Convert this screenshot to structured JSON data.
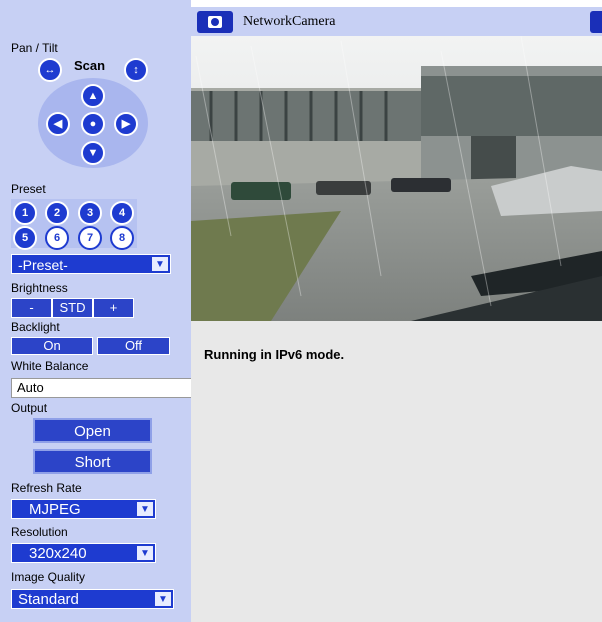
{
  "header": {
    "title": "NetworkCamera"
  },
  "pan_tilt": {
    "label": "Pan / Tilt",
    "scan_label": "Scan"
  },
  "preset": {
    "label": "Preset",
    "numbers": [
      "1",
      "2",
      "3",
      "4",
      "5",
      "6",
      "7",
      "8"
    ],
    "select_value": "-Preset-"
  },
  "brightness": {
    "label": "Brightness",
    "minus": "-",
    "std": "STD",
    "plus": "+"
  },
  "backlight": {
    "label": "Backlight",
    "on": "On",
    "off": "Off"
  },
  "white_balance": {
    "label": "White Balance",
    "value": "Auto"
  },
  "output": {
    "label": "Output",
    "open": "Open",
    "short": "Short"
  },
  "refresh_rate": {
    "label": "Refresh Rate",
    "value": "MJPEG"
  },
  "resolution": {
    "label": "Resolution",
    "value": "320x240"
  },
  "image_quality": {
    "label": "Image Quality",
    "value": "Standard"
  },
  "status": {
    "message": "Running in IPv6 mode."
  },
  "colors": {
    "sidebar_bg": "#c7d0f4",
    "button_blue": "#1e3bd0"
  }
}
